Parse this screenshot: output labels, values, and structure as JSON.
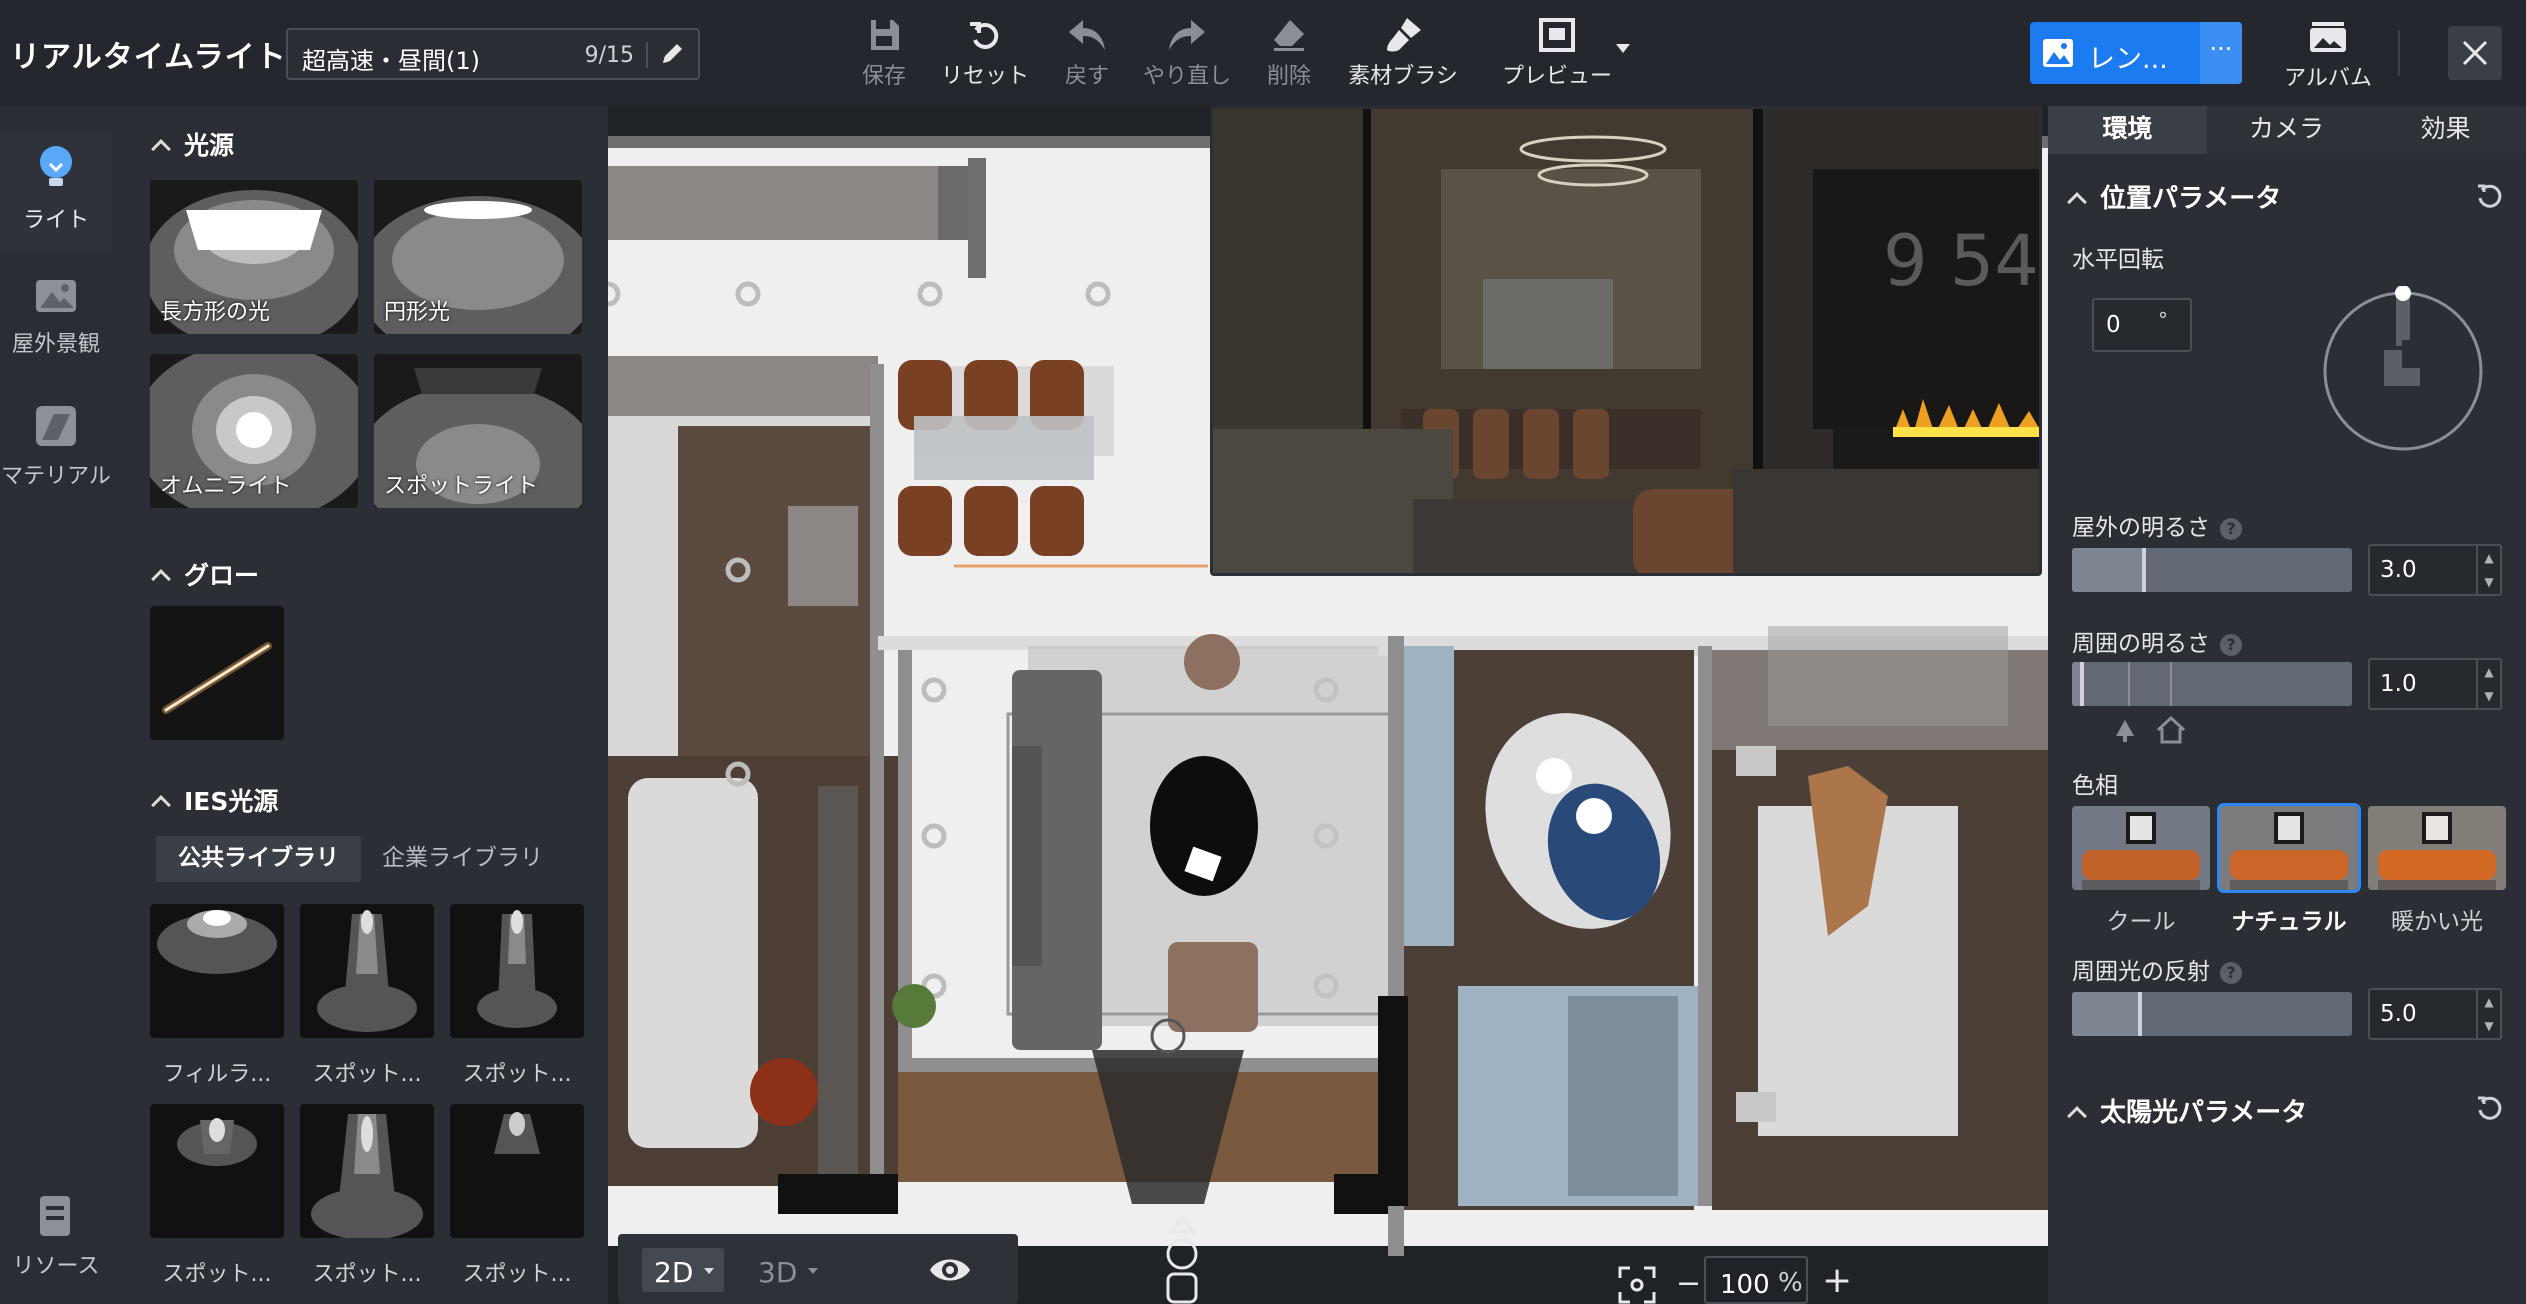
{
  "app": {
    "title": "リアルタイムライト",
    "scene_name": "超高速・昼間(1)",
    "scene_count": "9/15"
  },
  "toolbar": {
    "save": "保存",
    "reset": "リセット",
    "undo": "戻す",
    "redo": "やり直し",
    "delete": "削除",
    "material_brush": "素材ブラシ",
    "preview": "プレビュー",
    "render": "レン...",
    "render_more": "···",
    "album": "アルバム"
  },
  "rail": {
    "light": "ライト",
    "outdoor": "屋外景観",
    "material": "マテリアル",
    "resource": "リソース"
  },
  "library": {
    "light_source": {
      "title": "光源",
      "items": [
        "長方形の光",
        "円形光",
        "オムニライト",
        "スポットライト"
      ]
    },
    "glow": {
      "title": "グロー"
    },
    "ies": {
      "title": "IES光源",
      "tab_public": "公共ライブラリ",
      "tab_company": "企業ライブラリ",
      "items": [
        "フィルラ...",
        "スポット...",
        "スポット...",
        "スポット...",
        "スポット...",
        "スポット..."
      ]
    }
  },
  "canvas": {
    "view_2d": "2D",
    "view_3d": "3D",
    "zoom": "100",
    "zoom_unit": "%",
    "preview_wall_text": "9 54"
  },
  "right_panel": {
    "tabs": [
      "環境",
      "カメラ",
      "効果"
    ],
    "position_params": "位置パラメータ",
    "horizontal_rotation": "水平回転",
    "rotation_value": "0",
    "rotation_unit": "°",
    "outdoor_brightness": "屋外の明るさ",
    "outdoor_brightness_value": "3.0",
    "ambient_brightness": "周囲の明るさ",
    "ambient_brightness_value": "1.0",
    "hue": "色相",
    "hue_options": [
      "クール",
      "ナチュラル",
      "暖かい光"
    ],
    "hue_selected": 1,
    "ambient_reflection": "周囲光の反射",
    "ambient_reflection_value": "5.0",
    "sun_params": "太陽光パラメータ",
    "help": "?"
  },
  "colors": {
    "accent": "#1c7bf0",
    "bg": "#24272d",
    "panel": "#2b2e34"
  }
}
